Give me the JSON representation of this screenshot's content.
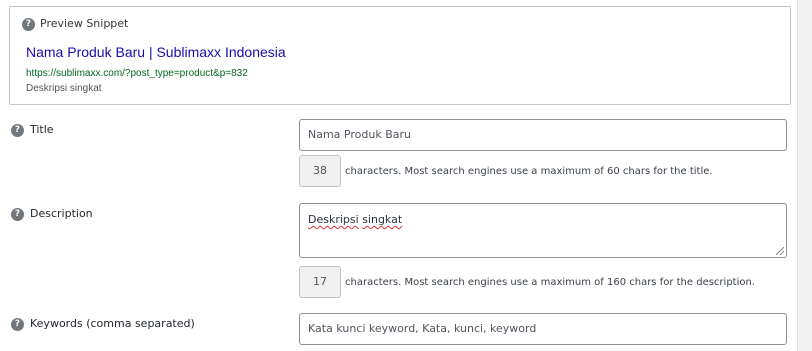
{
  "preview": {
    "label": "Preview Snippet",
    "title": "Nama Produk Baru | Sublimaxx Indonesia",
    "url": "https://sublimaxx.com/?post_type=product&p=832",
    "description": "Deskripsi singkat"
  },
  "title_field": {
    "label": "Title",
    "placeholder": "Nama Produk Baru",
    "count": "38",
    "note": "characters. Most search engines use a maximum of 60 chars for the title."
  },
  "description_field": {
    "label": "Description",
    "value_word1": "Deskripsi",
    "value_word2": "singkat",
    "count": "17",
    "note": "characters. Most search engines use a maximum of 160 chars for the description."
  },
  "keywords_field": {
    "label": "Keywords (comma separated)",
    "placeholder": "Kata kunci keyword, Kata, kunci, keyword"
  },
  "icons": {
    "help": "?"
  },
  "colors": {
    "snippet_title": "#1a0dab",
    "snippet_url": "#006621",
    "help_icon": "#72777c",
    "input_border": "#8c8f94"
  }
}
